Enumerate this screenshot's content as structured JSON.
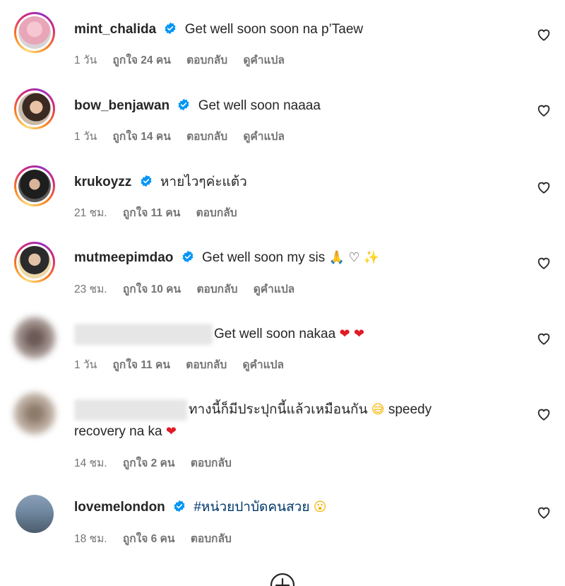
{
  "colors": {
    "text": "#262626",
    "meta": "#737373",
    "verified": "#0095f6",
    "hashtag": "#00376b"
  },
  "comments": [
    {
      "username": "mint_chalida",
      "verified": true,
      "text": "Get well soon soon na p’Taew",
      "time": "1 วัน",
      "likes": "ถูกใจ 24 คน",
      "reply": "ตอบกลับ",
      "translate": "ดูคำแปล"
    },
    {
      "username": "bow_benjawan",
      "verified": true,
      "text": "Get well soon naaaa",
      "time": "1 วัน",
      "likes": "ถูกใจ 14 คน",
      "reply": "ตอบกลับ",
      "translate": "ดูคำแปล"
    },
    {
      "username": "krukoyzz",
      "verified": true,
      "text": "หายไวๆค่ะแต้ว",
      "time": "21 ชม.",
      "likes": "ถูกใจ 11 คน",
      "reply": "ตอบกลับ"
    },
    {
      "username": "mutmeepimdao",
      "verified": true,
      "text": "Get well soon my sis",
      "emojis": [
        "folded-hands",
        "white-heart",
        "sparkles"
      ],
      "time": "23 ชม.",
      "likes": "ถูกใจ 10 คน",
      "reply": "ตอบกลับ",
      "translate": "ดูคำแปล"
    },
    {
      "username_hidden": true,
      "text": "Get well soon nakaa",
      "emojis": [
        "red-heart",
        "red-heart"
      ],
      "time": "1 วัน",
      "likes": "ถูกใจ 11 คน",
      "reply": "ตอบกลับ",
      "translate": "ดูคำแปล"
    },
    {
      "username_hidden": true,
      "text": "ทางนี้ก็มีประปุกนี้แล้วเหมือนกัน",
      "emoji_mid": "grinning-sweat",
      "text2": "speedy",
      "text3": "recovery na ka",
      "emoji_end": "red-heart",
      "time": "14 ชม.",
      "likes": "ถูกใจ 2 คน",
      "reply": "ตอบกลับ"
    },
    {
      "username": "lovemelondon",
      "verified": true,
      "text": "#หน่วยปาบัดคนสวย",
      "emojis": [
        "astonished-face"
      ],
      "time": "18 ชม.",
      "likes": "ถูกใจ 6 คน",
      "reply": "ตอบกลับ"
    }
  ],
  "icons": {
    "like": "heart-outline-icon",
    "verified": "verified-badge-icon",
    "more": "plus-circle-icon"
  }
}
